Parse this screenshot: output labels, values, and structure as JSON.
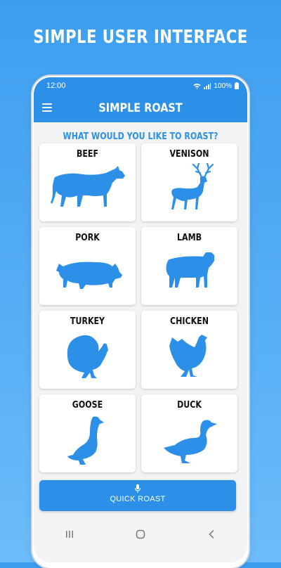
{
  "headline": "SIMPLE USER INTERFACE",
  "status_bar": {
    "time": "12:00",
    "battery": "100%"
  },
  "app_bar": {
    "title": "SIMPLE ROAST",
    "menu_icon": "hamburger-menu-icon"
  },
  "prompt": "WHAT WOULD YOU LIKE TO ROAST?",
  "meats": [
    {
      "label": "BEEF",
      "icon": "cow-silhouette-icon"
    },
    {
      "label": "VENISON",
      "icon": "deer-silhouette-icon"
    },
    {
      "label": "PORK",
      "icon": "pig-silhouette-icon"
    },
    {
      "label": "LAMB",
      "icon": "lamb-silhouette-icon"
    },
    {
      "label": "TURKEY",
      "icon": "turkey-silhouette-icon"
    },
    {
      "label": "CHICKEN",
      "icon": "chicken-silhouette-icon"
    },
    {
      "label": "GOOSE",
      "icon": "goose-silhouette-icon"
    },
    {
      "label": "DUCK",
      "icon": "duck-silhouette-icon"
    }
  ],
  "quick_roast": {
    "label": "QUICK ROAST",
    "icon": "microphone-icon"
  },
  "nav": {
    "recents_icon": "recents-icon",
    "home_icon": "home-icon",
    "back_icon": "back-icon"
  },
  "colors": {
    "accent": "#2d90e8",
    "background": "#4aa6f2",
    "card": "#ffffff",
    "screen_bg": "#f2f3f5"
  }
}
